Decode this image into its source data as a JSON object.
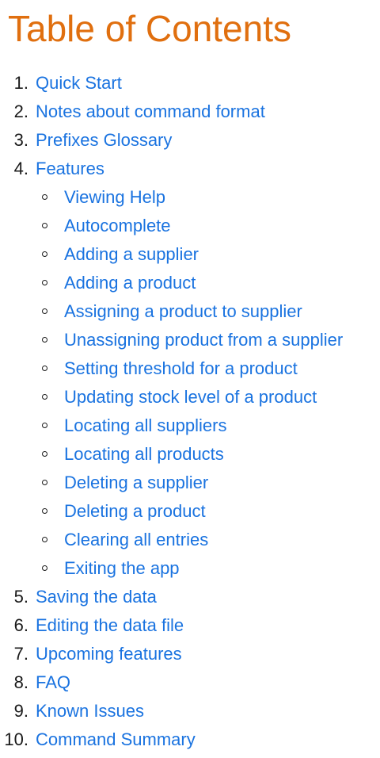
{
  "title": "Table of Contents",
  "toc": {
    "item_1": {
      "number": "1.",
      "label": "Quick Start"
    },
    "item_2": {
      "number": "2.",
      "label": "Notes about command format"
    },
    "item_3": {
      "number": "3.",
      "label": "Prefixes Glossary"
    },
    "item_4": {
      "number": "4.",
      "label": "Features",
      "sub": [
        "Viewing Help",
        "Autocomplete",
        "Adding a supplier",
        "Adding a product",
        "Assigning a product to supplier",
        "Unassigning product from a supplier",
        "Setting threshold for a product",
        "Updating stock level of a product",
        "Locating all suppliers",
        "Locating all products",
        "Deleting a supplier",
        "Deleting a product",
        "Clearing all entries",
        "Exiting the app"
      ]
    },
    "item_5": {
      "number": "5.",
      "label": "Saving the data"
    },
    "item_6": {
      "number": "6.",
      "label": "Editing the data file"
    },
    "item_7": {
      "number": "7.",
      "label": "Upcoming features"
    },
    "item_8": {
      "number": "8.",
      "label": "FAQ"
    },
    "item_9": {
      "number": "9.",
      "label": "Known Issues"
    },
    "item_10": {
      "number": "10.",
      "label": "Command Summary"
    }
  }
}
